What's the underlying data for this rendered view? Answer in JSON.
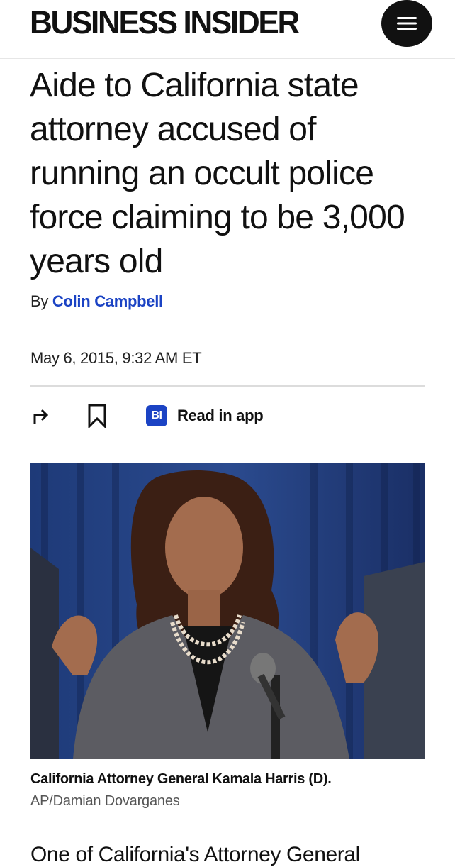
{
  "header": {
    "logo_text": "BUSINESS INSIDER",
    "menu_icon": "hamburger-menu-icon"
  },
  "article": {
    "headline": "Aide to California state attorney accused of running an occult police force claiming to be 3,000 years old",
    "byline_prefix": "By",
    "author": "Colin Campbell",
    "date": "May 6, 2015, 9:32 AM ET",
    "body_first_line_partial": "One of California's Attorney General"
  },
  "actions": {
    "share_icon": "share-arrow-icon",
    "bookmark_icon": "bookmark-icon",
    "app_badge": "BI",
    "read_in_app_label": "Read in app"
  },
  "image": {
    "caption": "California Attorney General Kamala Harris (D).",
    "credit": "AP/Damian Dovarganes"
  },
  "colors": {
    "link_blue": "#1b43c4",
    "text": "#111111",
    "divider": "#dcdcdc"
  }
}
